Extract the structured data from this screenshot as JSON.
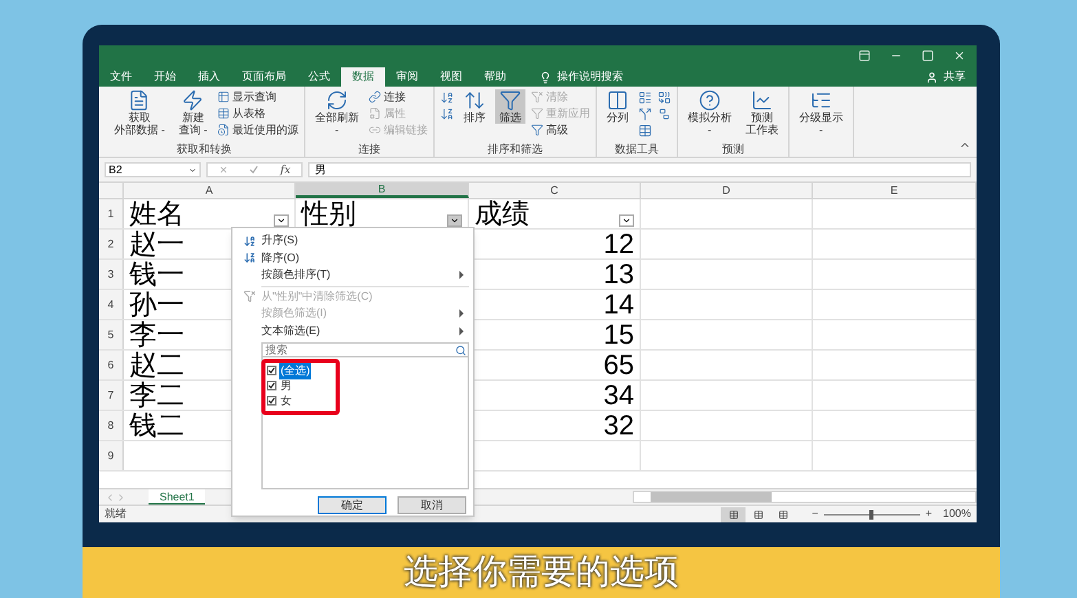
{
  "title_bar": {
    "controls": [
      {
        "kind": "display"
      },
      {
        "kind": "minimize"
      },
      {
        "kind": "maximize"
      },
      {
        "kind": "close"
      }
    ]
  },
  "tabs": [
    {
      "label": "文件",
      "selected": false
    },
    {
      "label": "开始",
      "selected": false
    },
    {
      "label": "插入",
      "selected": false
    },
    {
      "label": "页面布局",
      "selected": false
    },
    {
      "label": "公式",
      "selected": false
    },
    {
      "label": "数据",
      "selected": true
    },
    {
      "label": "审阅",
      "selected": false
    },
    {
      "label": "视图",
      "selected": false
    },
    {
      "label": "帮助",
      "selected": false
    }
  ],
  "tell_me": "操作说明搜索",
  "share": "共享",
  "ribbon": [
    {
      "label": "获取和转换",
      "columns": [
        [
          {
            "kind": "large",
            "lines": [
              "获取",
              "外部数据 -"
            ],
            "disabled": false,
            "on": false
          }
        ],
        [
          {
            "kind": "large",
            "lines": [
              "新建",
              "查询 -"
            ],
            "disabled": false,
            "on": false
          }
        ],
        [
          {
            "kind": "small",
            "label": "显示查询",
            "disabled": false,
            "on": false
          },
          {
            "kind": "small",
            "label": "从表格",
            "disabled": false,
            "on": false
          },
          {
            "kind": "small",
            "label": "最近使用的源",
            "disabled": false,
            "on": false
          }
        ]
      ]
    },
    {
      "label": "连接",
      "columns": [
        [
          {
            "kind": "large",
            "lines": [
              "全部刷新",
              "-"
            ],
            "disabled": false,
            "on": false
          }
        ],
        [
          {
            "kind": "small",
            "label": "连接",
            "disabled": false,
            "on": false
          },
          {
            "kind": "small",
            "label": "属性",
            "disabled": true,
            "on": false
          },
          {
            "kind": "small",
            "label": "编辑链接",
            "disabled": true,
            "on": false
          }
        ]
      ]
    },
    {
      "label": "排序和筛选",
      "columns": [
        [
          {
            "kind": "icon",
            "disabled": false,
            "on": false
          },
          {
            "kind": "icon",
            "disabled": false,
            "on": false
          }
        ],
        [
          {
            "kind": "large",
            "lines": [
              "排序"
            ],
            "disabled": false,
            "on": false
          }
        ],
        [
          {
            "kind": "large",
            "lines": [
              "筛选"
            ],
            "disabled": false,
            "on": true
          }
        ],
        [
          {
            "kind": "small",
            "label": "清除",
            "disabled": true,
            "on": false
          },
          {
            "kind": "small",
            "label": "重新应用",
            "disabled": true,
            "on": false
          },
          {
            "kind": "small",
            "label": "高级",
            "disabled": false,
            "on": false
          }
        ]
      ]
    },
    {
      "label": "数据工具",
      "columns": [
        [
          {
            "kind": "large",
            "lines": [
              "分列"
            ],
            "disabled": false,
            "on": false
          }
        ],
        [
          {
            "kind": "icon",
            "disabled": false,
            "on": false
          },
          {
            "kind": "icon",
            "disabled": false,
            "on": false
          },
          {
            "kind": "icon",
            "disabled": false,
            "on": false
          }
        ],
        [
          {
            "kind": "icon",
            "disabled": false,
            "on": false
          },
          {
            "kind": "icon",
            "disabled": false,
            "on": false
          }
        ]
      ]
    },
    {
      "label": "预测",
      "columns": [
        [
          {
            "kind": "large",
            "lines": [
              "模拟分析",
              "-"
            ],
            "disabled": false,
            "on": false
          }
        ],
        [
          {
            "kind": "large",
            "lines": [
              "预测",
              "工作表"
            ],
            "disabled": false,
            "on": false
          }
        ]
      ]
    },
    {
      "columns": [
        [
          {
            "kind": "large",
            "lines": [
              "分级显示",
              "-"
            ],
            "disabled": false,
            "on": false
          }
        ]
      ]
    }
  ],
  "name_box": "B2",
  "function_symbol": "fx",
  "formula": "男",
  "columns": [
    {
      "label": "A",
      "selected": false
    },
    {
      "label": "B",
      "selected": true
    },
    {
      "label": "C",
      "selected": false
    },
    {
      "label": "D",
      "selected": false
    },
    {
      "label": "E",
      "selected": false
    }
  ],
  "rows": [
    {
      "number": "1",
      "cells": [
        {
          "kind": "header",
          "text": "姓名",
          "active": false
        },
        {
          "kind": "header",
          "text": "性别",
          "active": true
        },
        {
          "kind": "header",
          "text": "成绩",
          "active": false
        }
      ]
    },
    {
      "number": "2",
      "cells": [
        {
          "kind": "text",
          "text": "赵一"
        },
        null,
        {
          "kind": "number",
          "text": "12"
        }
      ]
    },
    {
      "number": "3",
      "cells": [
        {
          "kind": "text",
          "text": "钱一"
        },
        null,
        {
          "kind": "number",
          "text": "13"
        }
      ]
    },
    {
      "number": "4",
      "cells": [
        {
          "kind": "text",
          "text": "孙一"
        },
        null,
        {
          "kind": "number",
          "text": "14"
        }
      ]
    },
    {
      "number": "5",
      "cells": [
        {
          "kind": "text",
          "text": "李一"
        },
        null,
        {
          "kind": "number",
          "text": "15"
        }
      ]
    },
    {
      "number": "6",
      "cells": [
        {
          "kind": "text",
          "text": "赵二"
        },
        null,
        {
          "kind": "number",
          "text": "65"
        }
      ]
    },
    {
      "number": "7",
      "cells": [
        {
          "kind": "text",
          "text": "李二"
        },
        null,
        {
          "kind": "number",
          "text": "34"
        }
      ]
    },
    {
      "number": "8",
      "cells": [
        {
          "kind": "text",
          "text": "钱二"
        },
        null,
        {
          "kind": "number",
          "text": "32"
        }
      ]
    },
    {
      "number": "9",
      "cells": []
    }
  ],
  "filter_menu": {
    "items": [
      {
        "kind": "ascending",
        "label": "升序(S)",
        "disabled": false
      },
      {
        "kind": "descending",
        "label": "降序(O)",
        "disabled": false
      },
      {
        "kind": "submenu",
        "label": "按颜色排序(T)",
        "disabled": false
      },
      {
        "kind": "separator"
      },
      {
        "kind": "clear",
        "label": "从\"性别\"中清除筛选(C)",
        "disabled": true
      },
      {
        "kind": "submenu",
        "label": "按颜色筛选(I)",
        "disabled": true
      },
      {
        "kind": "submenu",
        "label": "文本筛选(E)",
        "disabled": false
      }
    ],
    "search_placeholder": "搜索",
    "values": [
      {
        "label": "(全选)",
        "checked": true,
        "selected": true
      },
      {
        "label": "男",
        "checked": true,
        "selected": false
      },
      {
        "label": "女",
        "checked": true,
        "selected": false
      }
    ],
    "highlighted": true,
    "buttons": [
      {
        "label": "确定",
        "default": true
      },
      {
        "label": "取消",
        "default": false
      }
    ]
  },
  "sheets": [
    {
      "label": "Sheet1",
      "selected": true
    }
  ],
  "status": "就绪",
  "views": [
    {
      "selected": true
    },
    {
      "selected": false
    },
    {
      "selected": false
    }
  ],
  "zoom_out": "−",
  "zoom_in": "+",
  "zoom": {
    "level": 0.5,
    "reading": "100%"
  },
  "subtitle": "选择你需要的选项"
}
